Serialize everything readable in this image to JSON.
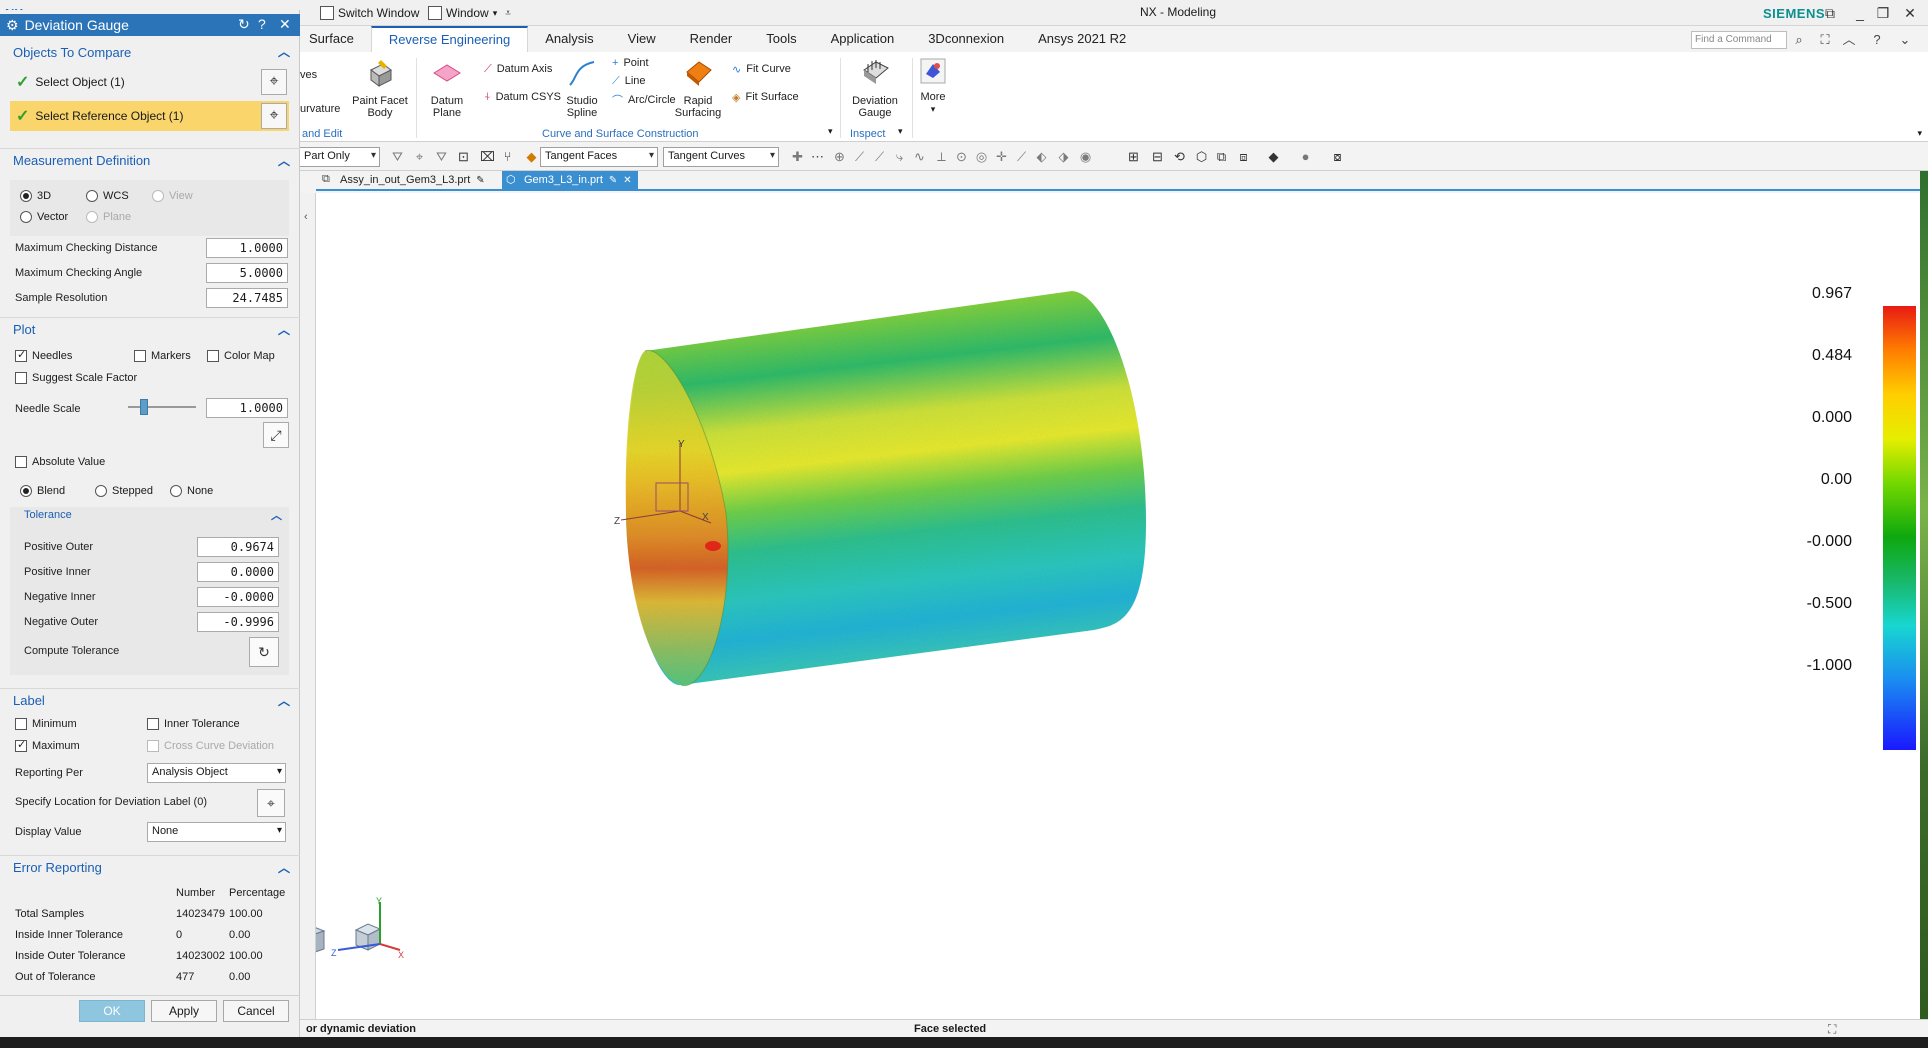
{
  "titlebar": {
    "nx_logo": "NX",
    "switch_window": "Switch Window",
    "window_menu": "Window",
    "app_title": "NX - Modeling",
    "brand": "SIEMENS"
  },
  "ribbon_tabs": [
    "Surface",
    "Reverse Engineering",
    "Analysis",
    "View",
    "Render",
    "Tools",
    "Application",
    "3Dconnexion",
    "Ansys 2021 R2"
  ],
  "find_command_placeholder": "Find a Command",
  "ribbon": {
    "partial_top": "ves",
    "partial_mid": "urvature",
    "partial_group": "and Edit",
    "paint_facet_body": "Paint Facet Body",
    "datum_plane": "Datum Plane",
    "datum_axis": "Datum Axis",
    "datum_csys": "Datum CSYS",
    "studio_spline": "Studio Spline",
    "point": "Point",
    "line": "Line",
    "arc_circle": "Arc/Circle",
    "rapid_surfacing": "Rapid Surfacing",
    "fit_curve": "Fit Curve",
    "fit_surface": "Fit Surface",
    "group_curve_surface": "Curve and Surface Construction",
    "deviation_gauge": "Deviation Gauge",
    "group_inspect": "Inspect",
    "more": "More"
  },
  "selection_bar": {
    "part_filter": "Part Only",
    "face_rule": "Tangent Faces",
    "curve_rule": "Tangent Curves"
  },
  "doc_tabs": [
    {
      "label": "Assy_in_out_Gem3_L3.prt"
    },
    {
      "label": "Gem3_L3_in.prt"
    }
  ],
  "legend": {
    "labels": [
      "0.967",
      "0.484",
      "0.000",
      "0.00",
      "-0.000",
      "-0.500",
      "-1.000"
    ],
    "colors": [
      "#e81b14",
      "#ffcf00",
      "#72d800",
      "#0ea80e",
      "#18d6d0",
      "#1a18ff"
    ]
  },
  "axis_labels": {
    "z": "Z",
    "y": "Y",
    "x": "X"
  },
  "status": {
    "left": "or dynamic deviation",
    "center": "Face selected"
  },
  "dialog": {
    "title": "Deviation Gauge",
    "objects_to_compare": {
      "header": "Objects To Compare",
      "select_object": "Select Object (1)",
      "select_reference": "Select Reference Object (1)"
    },
    "measurement": {
      "header": "Measurement Definition",
      "r3d": "3D",
      "wcs": "WCS",
      "view": "View",
      "vector": "Vector",
      "plane": "Plane",
      "max_dist_label": "Maximum Checking Distance",
      "max_dist": "1.0000",
      "max_angle_label": "Maximum Checking Angle",
      "max_angle": "5.0000",
      "sample_res_label": "Sample Resolution",
      "sample_res": "24.7485"
    },
    "plot": {
      "header": "Plot",
      "needles": "Needles",
      "markers": "Markers",
      "color_map": "Color Map",
      "suggest_scale": "Suggest Scale Factor",
      "needle_scale_label": "Needle Scale",
      "needle_scale": "1.0000",
      "absolute_value": "Absolute Value",
      "blend": "Blend",
      "stepped": "Stepped",
      "none": "None",
      "tolerance_header": "Tolerance",
      "pos_outer_label": "Positive Outer",
      "pos_outer": "0.9674",
      "pos_inner_label": "Positive Inner",
      "pos_inner": "0.0000",
      "neg_inner_label": "Negative Inner",
      "neg_inner": "-0.0000",
      "neg_outer_label": "Negative Outer",
      "neg_outer": "-0.9996",
      "compute_tol": "Compute Tolerance"
    },
    "label": {
      "header": "Label",
      "minimum": "Minimum",
      "inner_tol": "Inner Tolerance",
      "maximum": "Maximum",
      "cross_curve": "Cross Curve Deviation",
      "reporting_per_label": "Reporting Per",
      "reporting_per": "Analysis Object",
      "specify_location": "Specify Location for Deviation Label (0)",
      "display_value_label": "Display Value",
      "display_value": "None"
    },
    "error_reporting": {
      "header": "Error Reporting",
      "col_number": "Number",
      "col_percentage": "Percentage",
      "rows": [
        {
          "label": "Total Samples",
          "number": "14023479",
          "pct": "100.00"
        },
        {
          "label": "Inside Inner Tolerance",
          "number": "0",
          "pct": "0.00"
        },
        {
          "label": "Inside Outer Tolerance",
          "number": "14023002",
          "pct": "100.00"
        },
        {
          "label": "Out of Tolerance",
          "number": "477",
          "pct": "0.00"
        }
      ]
    },
    "buttons": {
      "ok": "OK",
      "apply": "Apply",
      "cancel": "Cancel"
    }
  }
}
